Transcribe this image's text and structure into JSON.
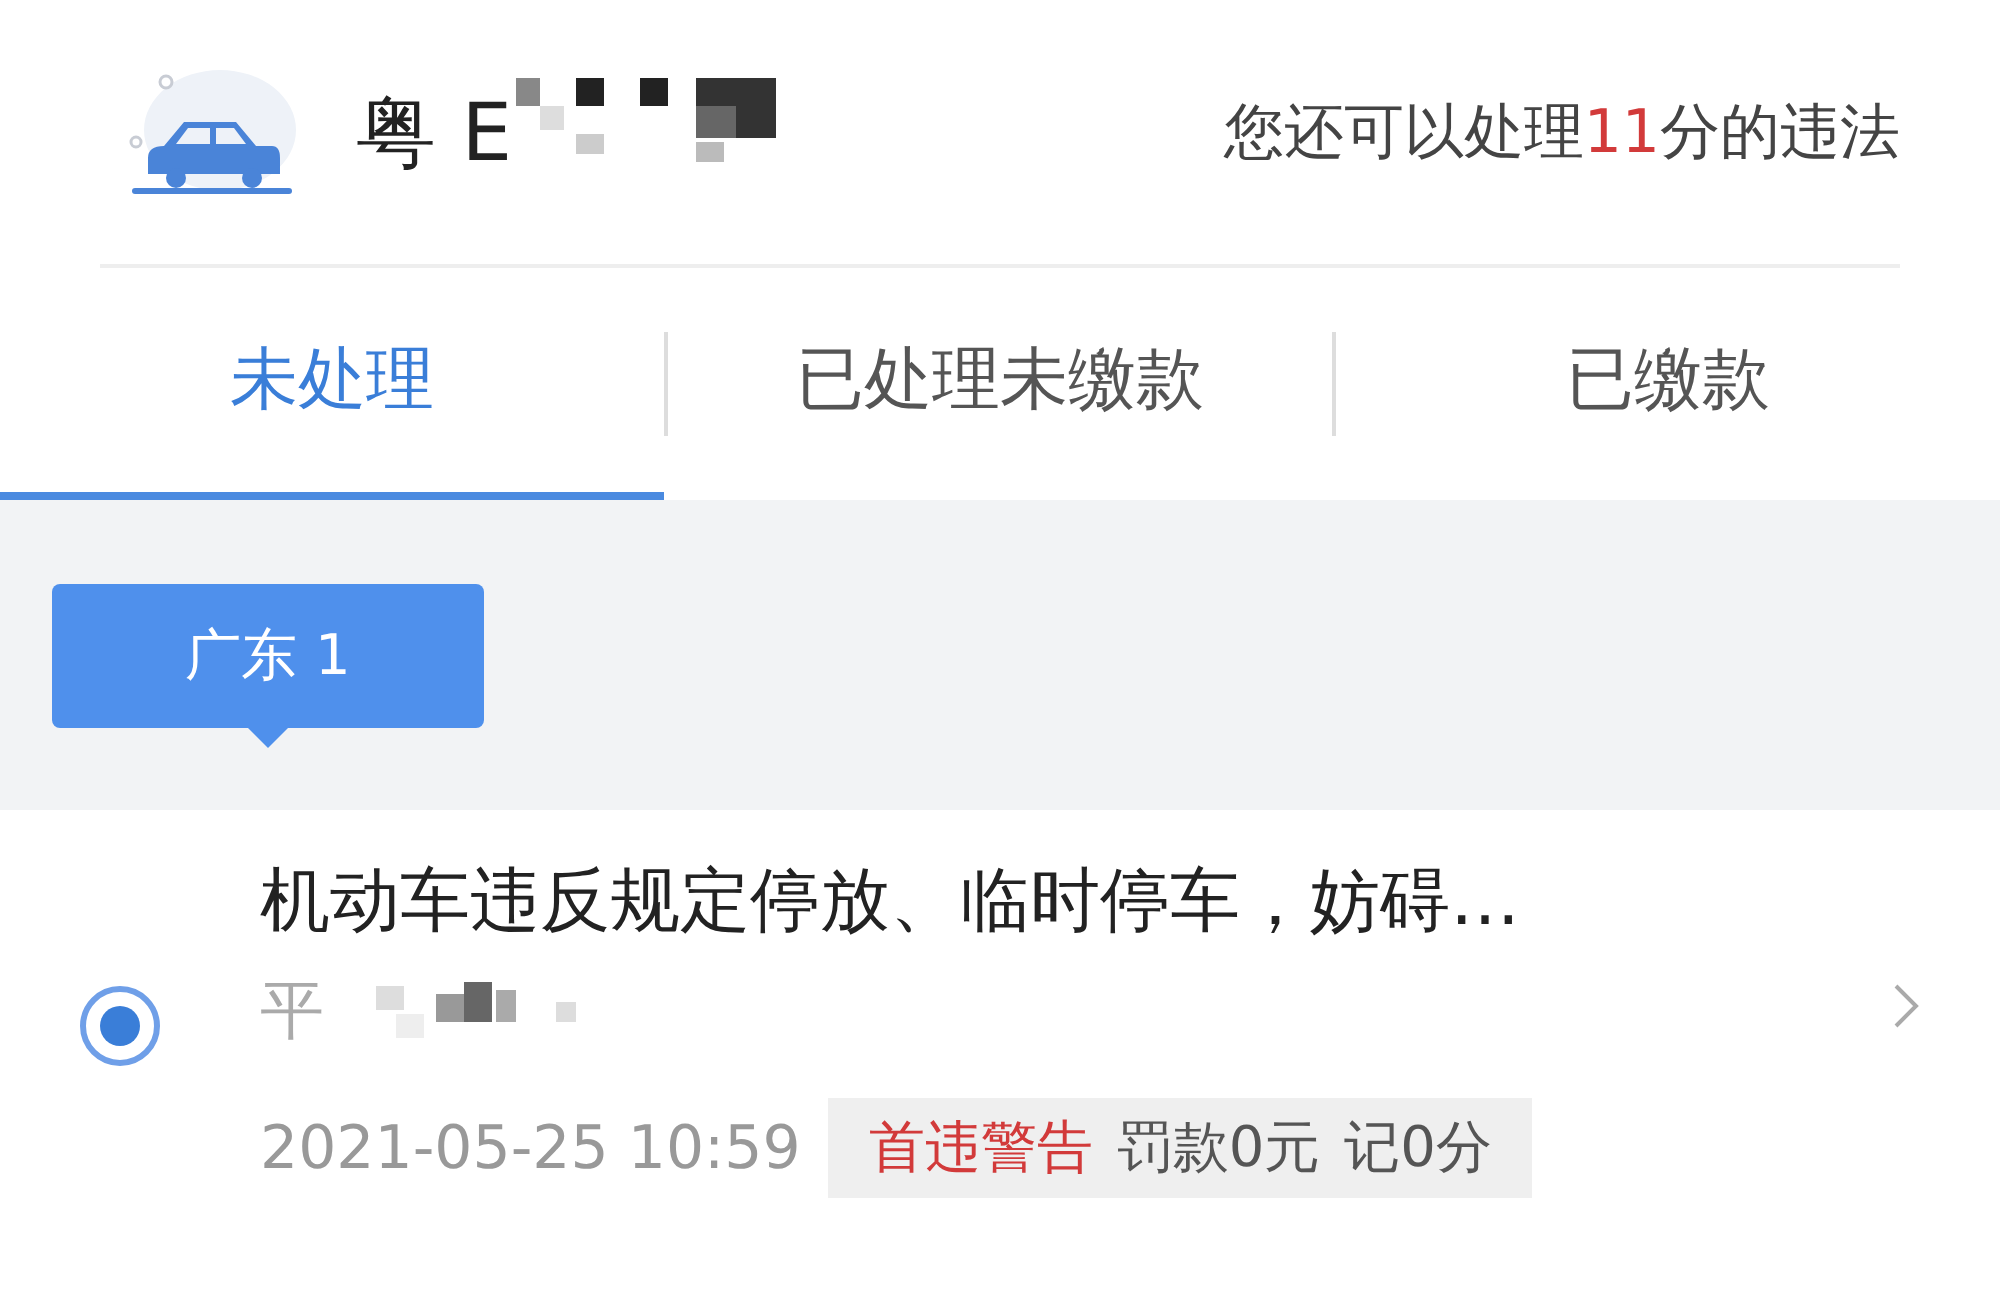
{
  "vehicle": {
    "plate": "粤 E",
    "remaining_prefix": "您还可以处理",
    "remaining_points": "11",
    "remaining_suffix": "分的违法"
  },
  "tabs": [
    {
      "label": "未处理",
      "selected": true
    },
    {
      "label": "已处理未缴款",
      "selected": false
    },
    {
      "label": "已缴款",
      "selected": false
    }
  ],
  "regions": [
    {
      "label": "广东 1",
      "selected": true
    }
  ],
  "violations": [
    {
      "title": "机动车违反规定停放、临时停车，妨碍…",
      "location": "平",
      "time": "2021-05-25 10:59",
      "selected": true,
      "tags": [
        {
          "kind": "warning",
          "text": "首违警告"
        },
        {
          "kind": "info",
          "text": "罚款0元"
        },
        {
          "kind": "info",
          "text": "记0分"
        }
      ]
    }
  ]
}
